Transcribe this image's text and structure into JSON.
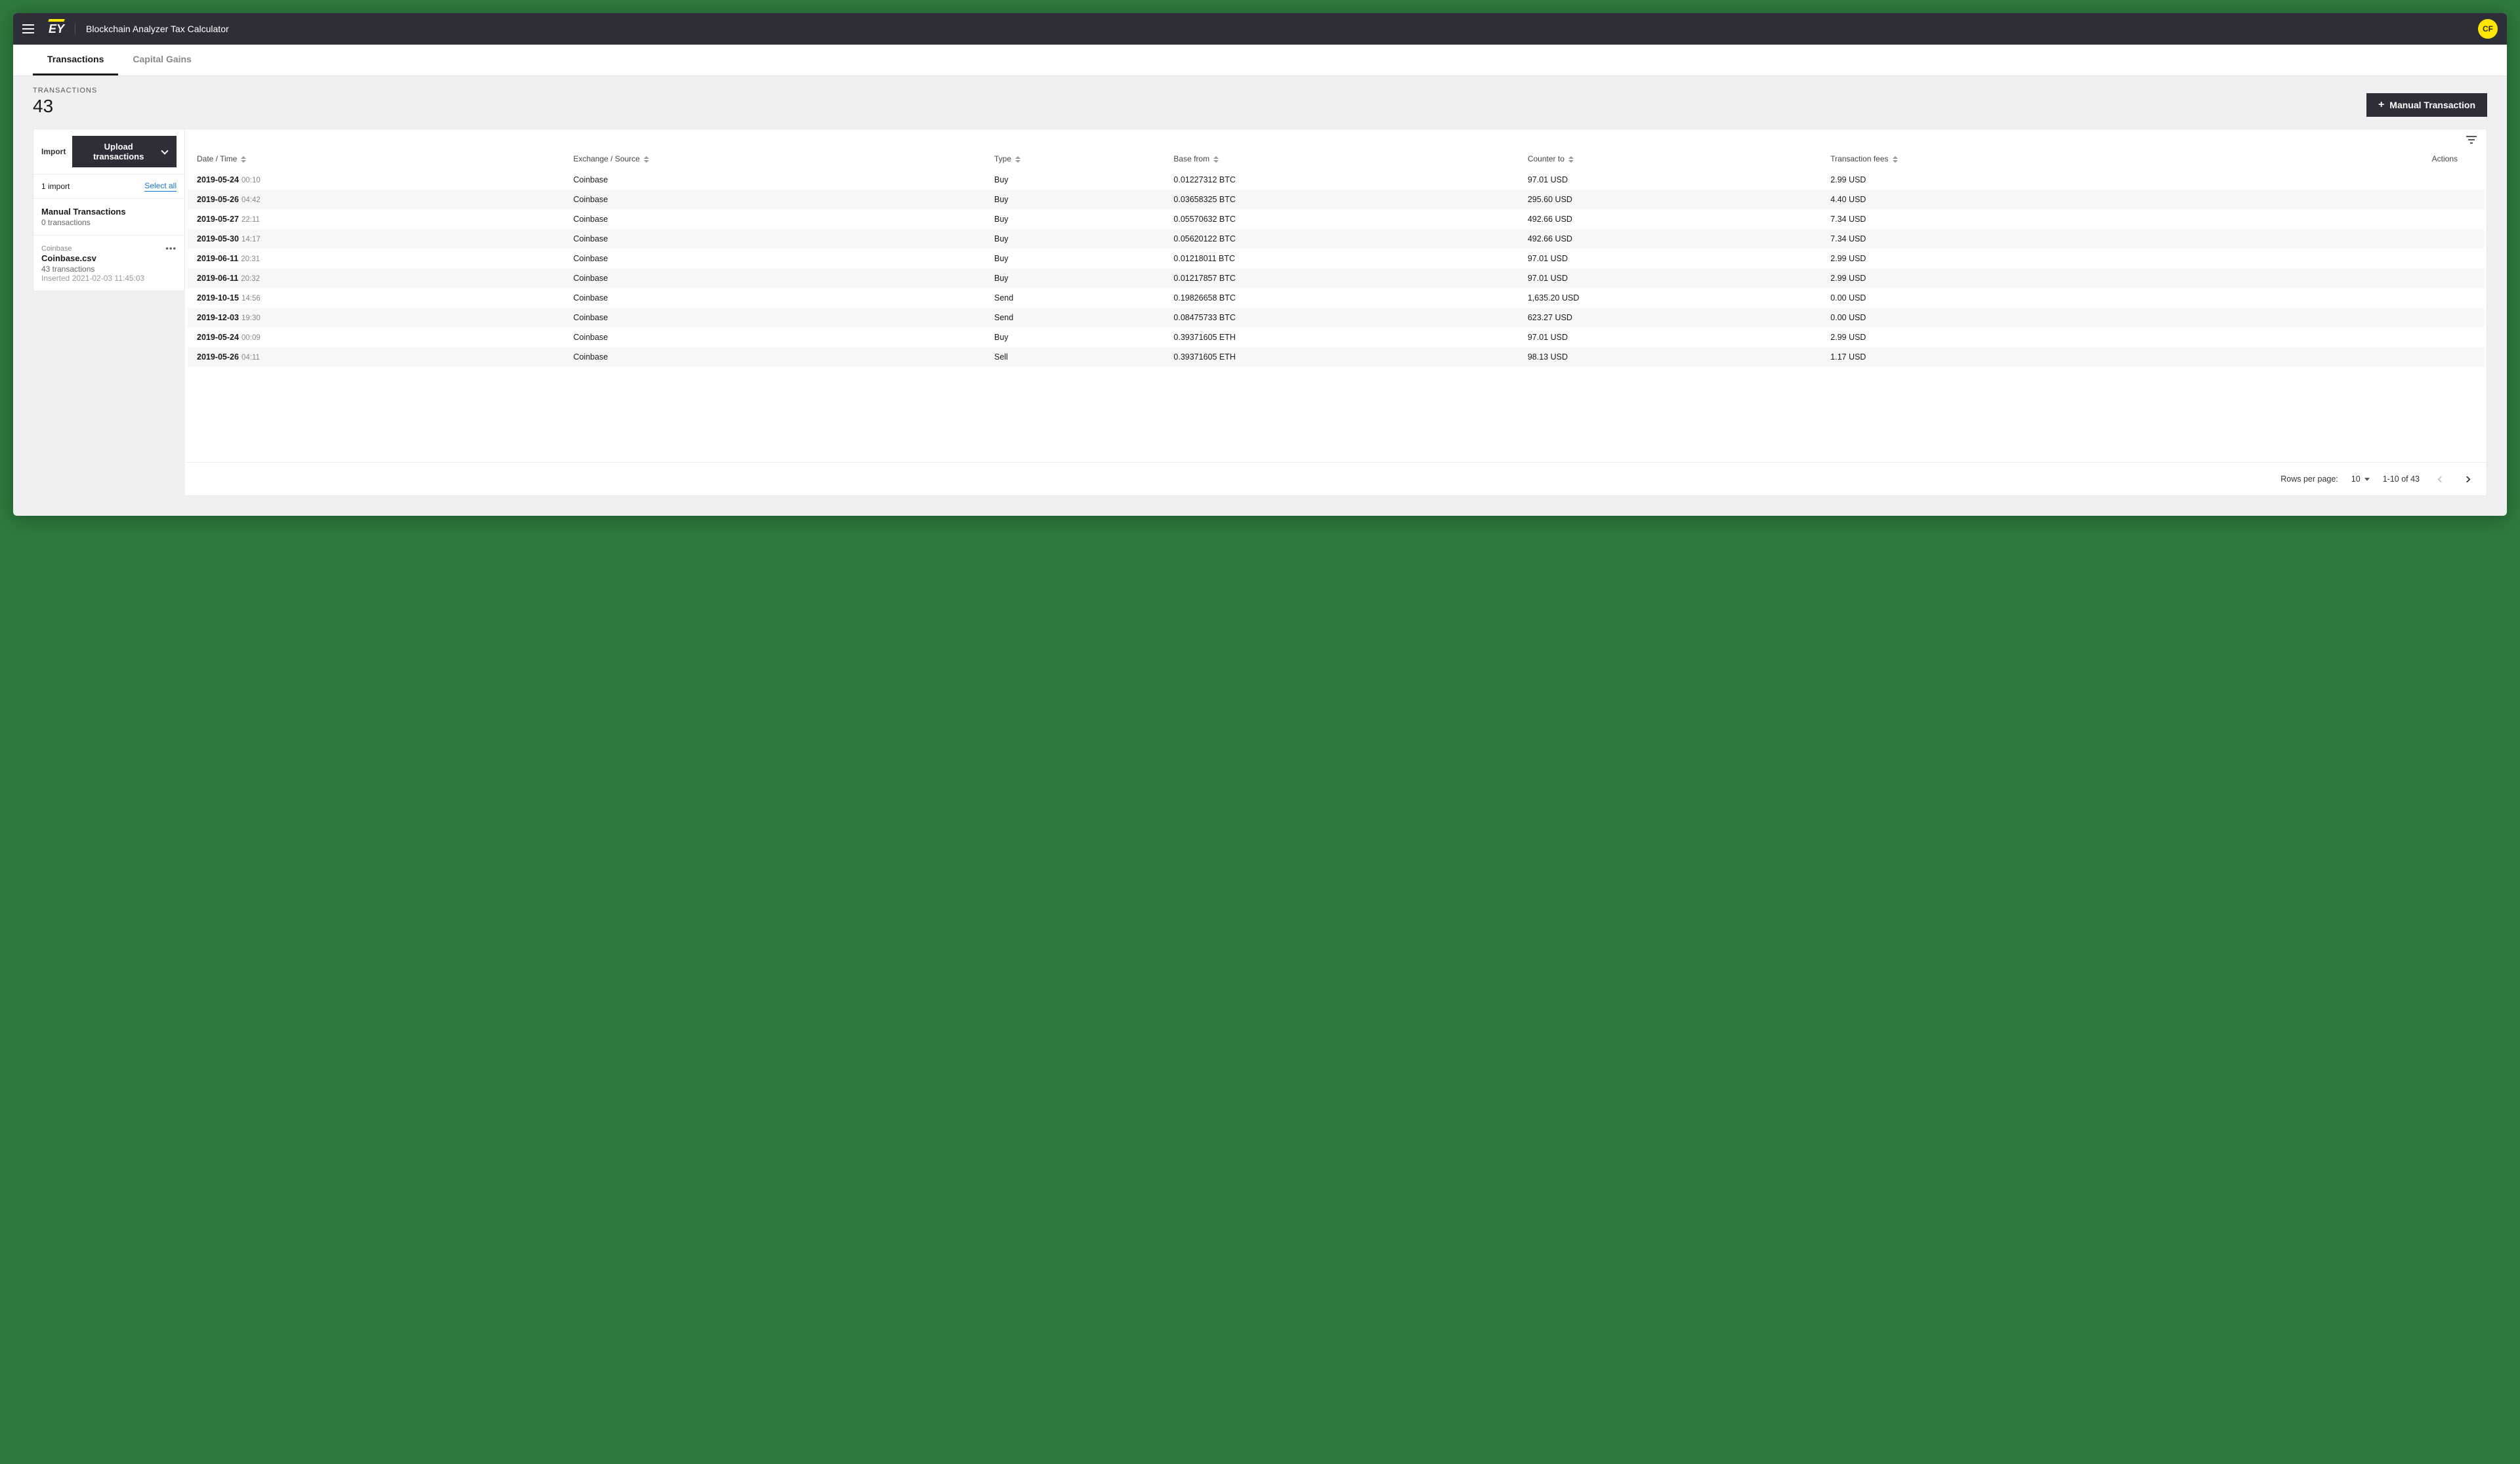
{
  "header": {
    "app_title": "Blockchain Analyzer Tax Calculator",
    "logo_text": "EY",
    "avatar_initials": "CF"
  },
  "tabs": [
    {
      "label": "Transactions",
      "active": true
    },
    {
      "label": "Capital Gains",
      "active": false
    }
  ],
  "counter": {
    "label": "TRANSACTIONS",
    "value": "43"
  },
  "manual_button_label": "Manual Transaction",
  "sidebar": {
    "import_label": "Import",
    "upload_label": "Upload transactions",
    "imports_count_label": "1 import",
    "select_all_label": "Select all",
    "manual_block": {
      "title": "Manual Transactions",
      "subtitle": "0 transactions"
    },
    "import_block": {
      "source": "Coinbase",
      "filename": "Coinbase.csv",
      "count": "43 transactions",
      "inserted": "Inserted 2021-02-03 11:45:03"
    }
  },
  "table": {
    "columns": {
      "date": "Date / Time",
      "exchange": "Exchange / Source",
      "type": "Type",
      "base": "Base from",
      "counter": "Counter to",
      "fees": "Transaction fees",
      "actions": "Actions"
    },
    "rows": [
      {
        "date": "2019-05-24",
        "time": "00:10",
        "exchange": "Coinbase",
        "type": "Buy",
        "base": "0.01227312 BTC",
        "counter": "97.01 USD",
        "fees": "2.99 USD"
      },
      {
        "date": "2019-05-26",
        "time": "04:42",
        "exchange": "Coinbase",
        "type": "Buy",
        "base": "0.03658325 BTC",
        "counter": "295.60 USD",
        "fees": "4.40 USD"
      },
      {
        "date": "2019-05-27",
        "time": "22:11",
        "exchange": "Coinbase",
        "type": "Buy",
        "base": "0.05570632 BTC",
        "counter": "492.66 USD",
        "fees": "7.34 USD"
      },
      {
        "date": "2019-05-30",
        "time": "14:17",
        "exchange": "Coinbase",
        "type": "Buy",
        "base": "0.05620122 BTC",
        "counter": "492.66 USD",
        "fees": "7.34 USD"
      },
      {
        "date": "2019-06-11",
        "time": "20:31",
        "exchange": "Coinbase",
        "type": "Buy",
        "base": "0.01218011 BTC",
        "counter": "97.01 USD",
        "fees": "2.99 USD"
      },
      {
        "date": "2019-06-11",
        "time": "20:32",
        "exchange": "Coinbase",
        "type": "Buy",
        "base": "0.01217857 BTC",
        "counter": "97.01 USD",
        "fees": "2.99 USD"
      },
      {
        "date": "2019-10-15",
        "time": "14:56",
        "exchange": "Coinbase",
        "type": "Send",
        "base": "0.19826658 BTC",
        "counter": "1,635.20 USD",
        "fees": "0.00 USD"
      },
      {
        "date": "2019-12-03",
        "time": "19:30",
        "exchange": "Coinbase",
        "type": "Send",
        "base": "0.08475733 BTC",
        "counter": "623.27 USD",
        "fees": "0.00 USD"
      },
      {
        "date": "2019-05-24",
        "time": "00:09",
        "exchange": "Coinbase",
        "type": "Buy",
        "base": "0.39371605 ETH",
        "counter": "97.01 USD",
        "fees": "2.99 USD"
      },
      {
        "date": "2019-05-26",
        "time": "04:11",
        "exchange": "Coinbase",
        "type": "Sell",
        "base": "0.39371605 ETH",
        "counter": "98.13 USD",
        "fees": "1.17 USD"
      }
    ]
  },
  "pagination": {
    "rows_label": "Rows per page:",
    "rows_value": "10",
    "range_label": "1-10 of 43"
  }
}
